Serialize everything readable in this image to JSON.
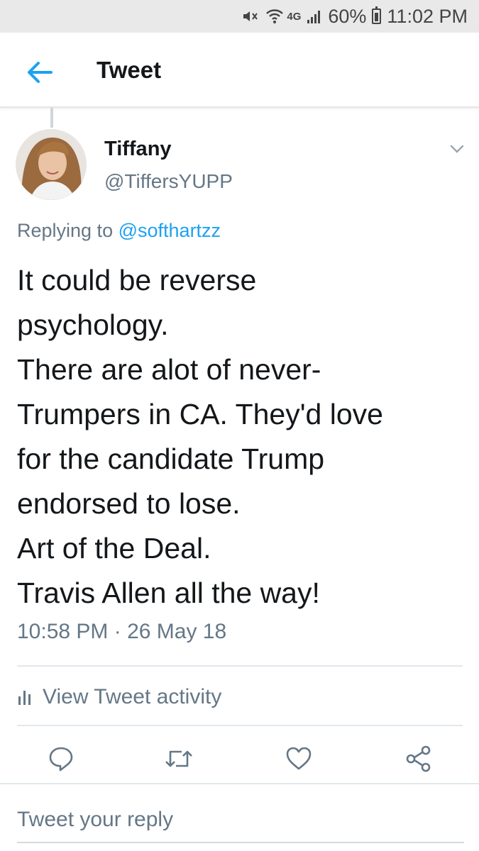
{
  "status_bar": {
    "network": "4G",
    "battery": "60%",
    "time": "11:02 PM",
    "icons": [
      "mute-icon",
      "wifi-icon",
      "signal-icon",
      "battery-icon"
    ]
  },
  "header": {
    "title": "Tweet",
    "back_icon": "arrow-left-icon"
  },
  "tweet": {
    "author_name": "Tiffany",
    "author_handle": "@TiffersYUPP",
    "replying_prefix": "Replying to",
    "replying_mention": "@softhartzz",
    "text_lines": [
      "It could be reverse",
      "psychology.",
      "There are alot of never-",
      "Trumpers in CA. They'd love",
      "for the candidate Trump",
      "endorsed to lose.",
      "Art of the Deal.",
      "Travis Allen all the way!"
    ],
    "timestamp": "10:58 PM · 26 May 18"
  },
  "activity_label": "View Tweet activity",
  "actions": [
    "reply-icon",
    "retweet-icon",
    "like-icon",
    "share-icon"
  ],
  "reply_box": {
    "placeholder": "Tweet your reply"
  },
  "colors": {
    "accent": "#1da1f2",
    "secondary_text": "#657786",
    "primary_text": "#14171a"
  }
}
